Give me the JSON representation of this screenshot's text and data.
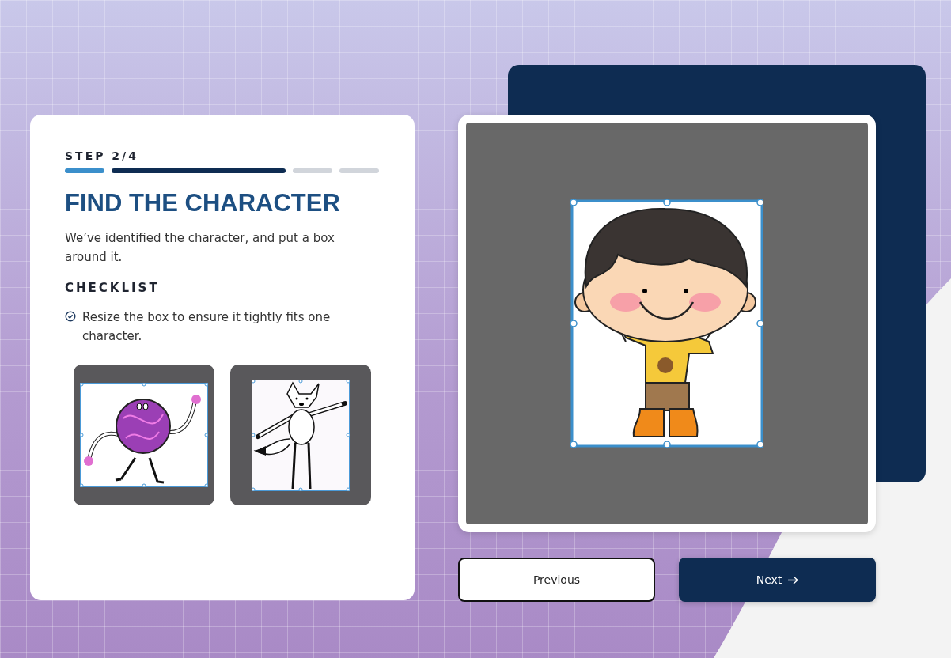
{
  "step": {
    "label": "STEP 2/4",
    "segments": [
      {
        "kind": "done"
      },
      {
        "kind": "current"
      },
      {
        "kind": "todo"
      },
      {
        "kind": "todo"
      }
    ]
  },
  "title": "FIND THE CHARACTER",
  "description": "We’ve identified the character, and put a box around it.",
  "checklist": {
    "heading": "CHECKLIST",
    "items": [
      {
        "text": "Resize the box to ensure it tightly fits one character.",
        "checked": true
      }
    ]
  },
  "examples": [
    {
      "kind": "blob"
    },
    {
      "kind": "fox"
    }
  ],
  "canvas": {
    "kind": "boy"
  },
  "buttons": {
    "previous": "Previous",
    "next": "Next"
  }
}
